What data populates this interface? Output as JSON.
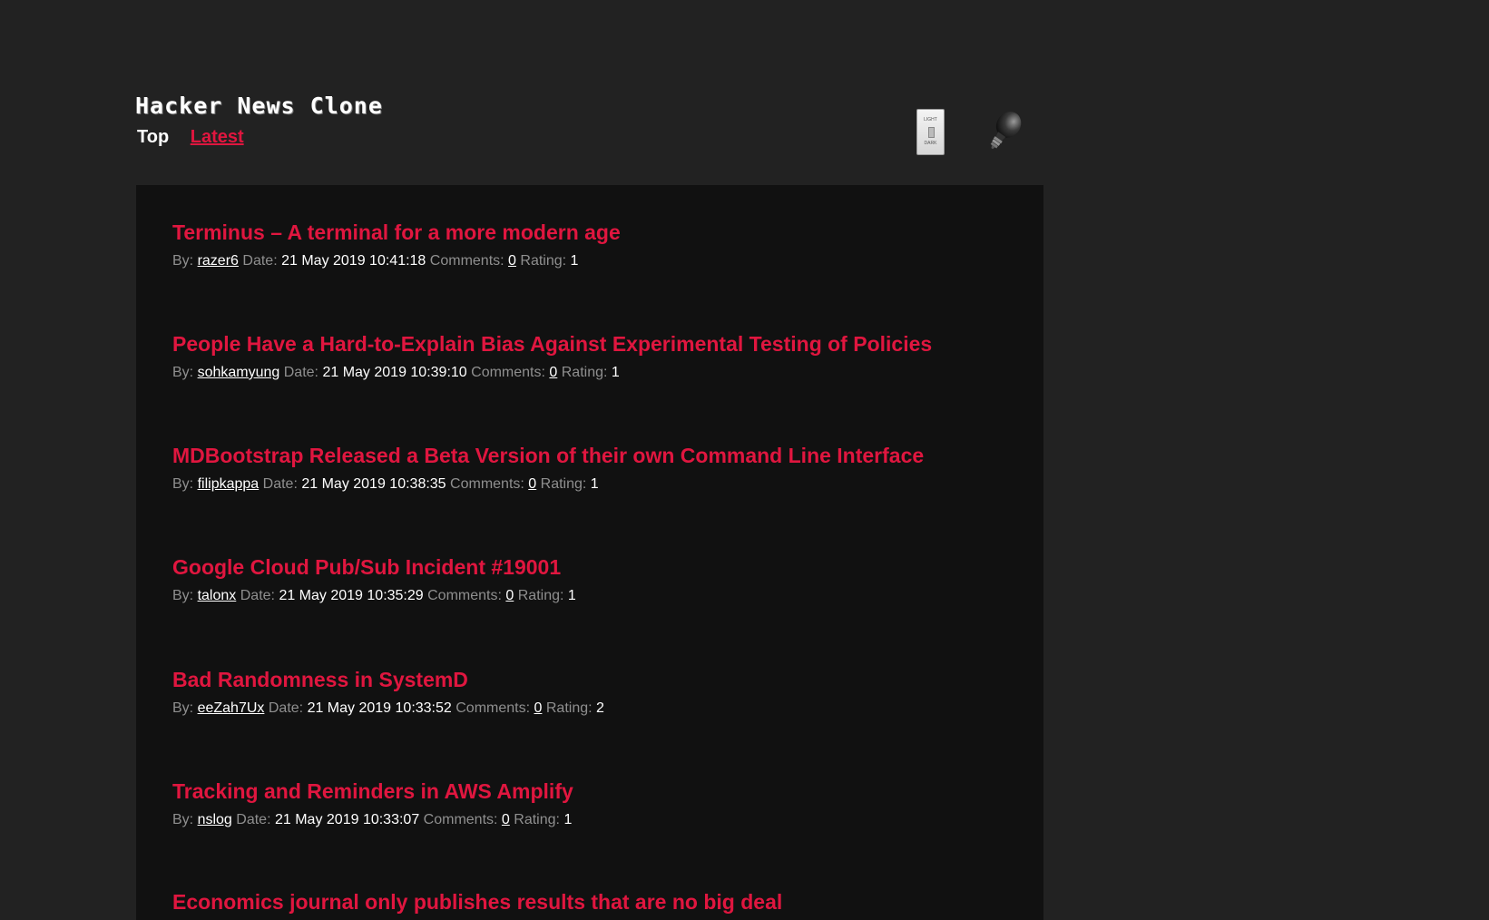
{
  "header": {
    "title": "Hacker News Clone",
    "nav": {
      "top": "Top",
      "latest": "Latest"
    },
    "theme_switch": {
      "light": "LIGHT",
      "dark": "DARK",
      "icon": "light-switch-icon"
    },
    "bulb_icon": "light-bulb-icon"
  },
  "colors": {
    "background": "#222222",
    "content_background": "#111111",
    "accent": "#e0163f",
    "text": "#ffffff",
    "muted": "#8f8f8f"
  },
  "labels": {
    "by": "By:",
    "date": "Date:",
    "comments": "Comments:",
    "rating": "Rating:"
  },
  "stories": [
    {
      "title": "Terminus – A terminal for a more modern age",
      "author": "razer6",
      "date": "21 May 2019 10:41:18",
      "comments": "0",
      "rating": "1"
    },
    {
      "title": "People Have a Hard-to-Explain Bias Against Experimental Testing of Policies",
      "author": "sohkamyung",
      "date": "21 May 2019 10:39:10",
      "comments": "0",
      "rating": "1"
    },
    {
      "title": "MDBootstrap Released a Beta Version of their own Command Line Interface",
      "author": "filipkappa",
      "date": "21 May 2019 10:38:35",
      "comments": "0",
      "rating": "1"
    },
    {
      "title": "Google Cloud Pub/Sub Incident #19001",
      "author": "talonx",
      "date": "21 May 2019 10:35:29",
      "comments": "0",
      "rating": "1"
    },
    {
      "title": "Bad Randomness in SystemD",
      "author": "eeZah7Ux",
      "date": "21 May 2019 10:33:52",
      "comments": "0",
      "rating": "2"
    },
    {
      "title": "Tracking and Reminders in AWS Amplify",
      "author": "nslog",
      "date": "21 May 2019 10:33:07",
      "comments": "0",
      "rating": "1"
    },
    {
      "title": "Economics journal only publishes results that are no big deal"
    }
  ]
}
